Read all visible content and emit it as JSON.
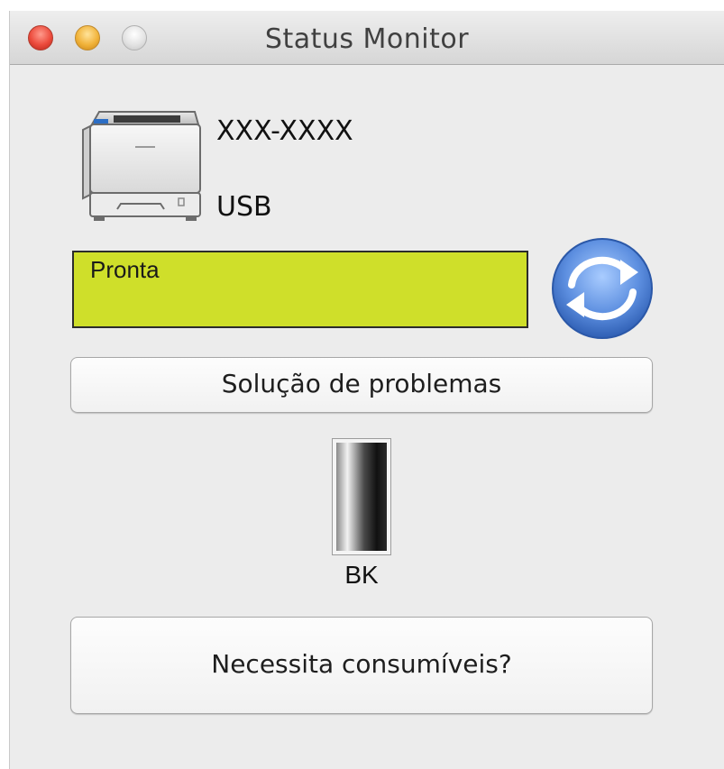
{
  "window": {
    "title": "Status Monitor"
  },
  "device": {
    "model": "XXX-XXXX",
    "connection": "USB",
    "icon": "printer-icon"
  },
  "status": {
    "text": "Pronta",
    "color": "#cfdf2a"
  },
  "refresh": {
    "icon": "refresh-icon",
    "color": "#4a7fd6"
  },
  "buttons": {
    "troubleshoot": "Solução de problemas",
    "supplies": "Necessita consumíveis?"
  },
  "toner": {
    "label": "BK"
  }
}
